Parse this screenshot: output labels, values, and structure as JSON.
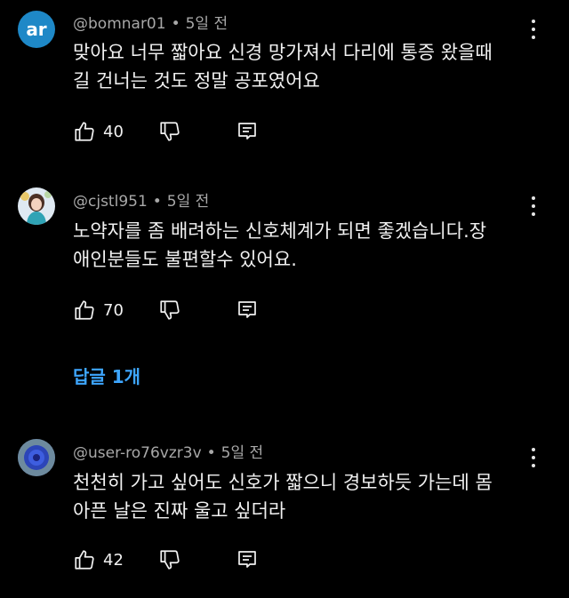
{
  "comments": [
    {
      "avatar_text": "ar",
      "author": "@bomnar01",
      "separator": "•",
      "time": "5일 전",
      "text": "맞아요 너무 짧아요 신경 망가져서 다리에 통증 왔을때\n길 건너는 것도 정말 공포였어요",
      "likes": "40"
    },
    {
      "author": "@cjstl951",
      "separator": "•",
      "time": "5일 전",
      "text": "노약자를 좀 배려하는 신호체계가 되면 좋겠습니다.장\n애인분들도 불편할수 있어요.",
      "likes": "70"
    },
    {
      "author": "@user-ro76vzr3v",
      "separator": "•",
      "time": "5일 전",
      "text": "천천히 가고 싶어도 신호가 짧으니 경보하듯 가는데 몸\n아픈 날은 진짜 울고 싶더라",
      "likes": "42"
    }
  ],
  "replies_label": "답글 1개",
  "colors": {
    "background": "#000000",
    "text": "#f1f1f1",
    "meta": "#a8a8a8",
    "link": "#3ea6ff",
    "avatar_ar": "#1e88c7"
  },
  "icons": [
    "like-icon",
    "dislike-icon",
    "reply-icon",
    "more-vert-icon"
  ]
}
